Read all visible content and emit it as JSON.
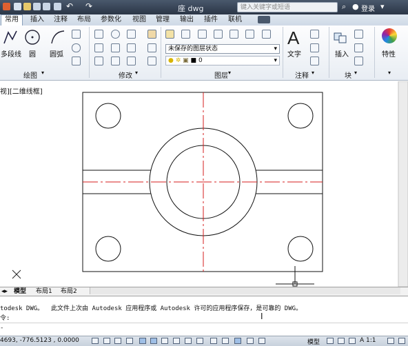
{
  "title_bar": {
    "title": "座 dwg",
    "search_placeholder": "键入关键字或短语",
    "login_label": "登录"
  },
  "tabs": [
    "常用",
    "插入",
    "注释",
    "布局",
    "参数化",
    "视图",
    "管理",
    "输出",
    "插件",
    "联机"
  ],
  "ribbon": {
    "draw": {
      "group_label": "绘图",
      "polyline_label": "多段线",
      "circle_label": "圆",
      "arc_label": "圆弧"
    },
    "modify": {
      "group_label": "修改"
    },
    "layers": {
      "group_label": "图层",
      "layer_state": "未保存的图层状态",
      "current_layer": "0"
    },
    "annotation": {
      "group_label": "注释",
      "text_label": "文字"
    },
    "block": {
      "group_label": "块",
      "insert_label": "插入"
    },
    "properties": {
      "label": "特性"
    }
  },
  "viewport": {
    "label": "视][二维线框]"
  },
  "layout_tabs": [
    "模型",
    "布局1",
    "布局2"
  ],
  "command_line": {
    "history": "todesk DWG。  此文件上次由 Autodesk 应用程序或 Autodesk 许可的应用程序保存，是可靠的 DWG。",
    "prompt": "令:",
    "extra": "-"
  },
  "status_bar": {
    "coordinates": "4693, -776.5123 , 0.0000",
    "model_label": "模型",
    "scale": "A 1:1"
  },
  "colors": {
    "title_bar": "#2f3b4d",
    "center_lines": "#d41c1c",
    "drawing_lines": "#111111"
  }
}
